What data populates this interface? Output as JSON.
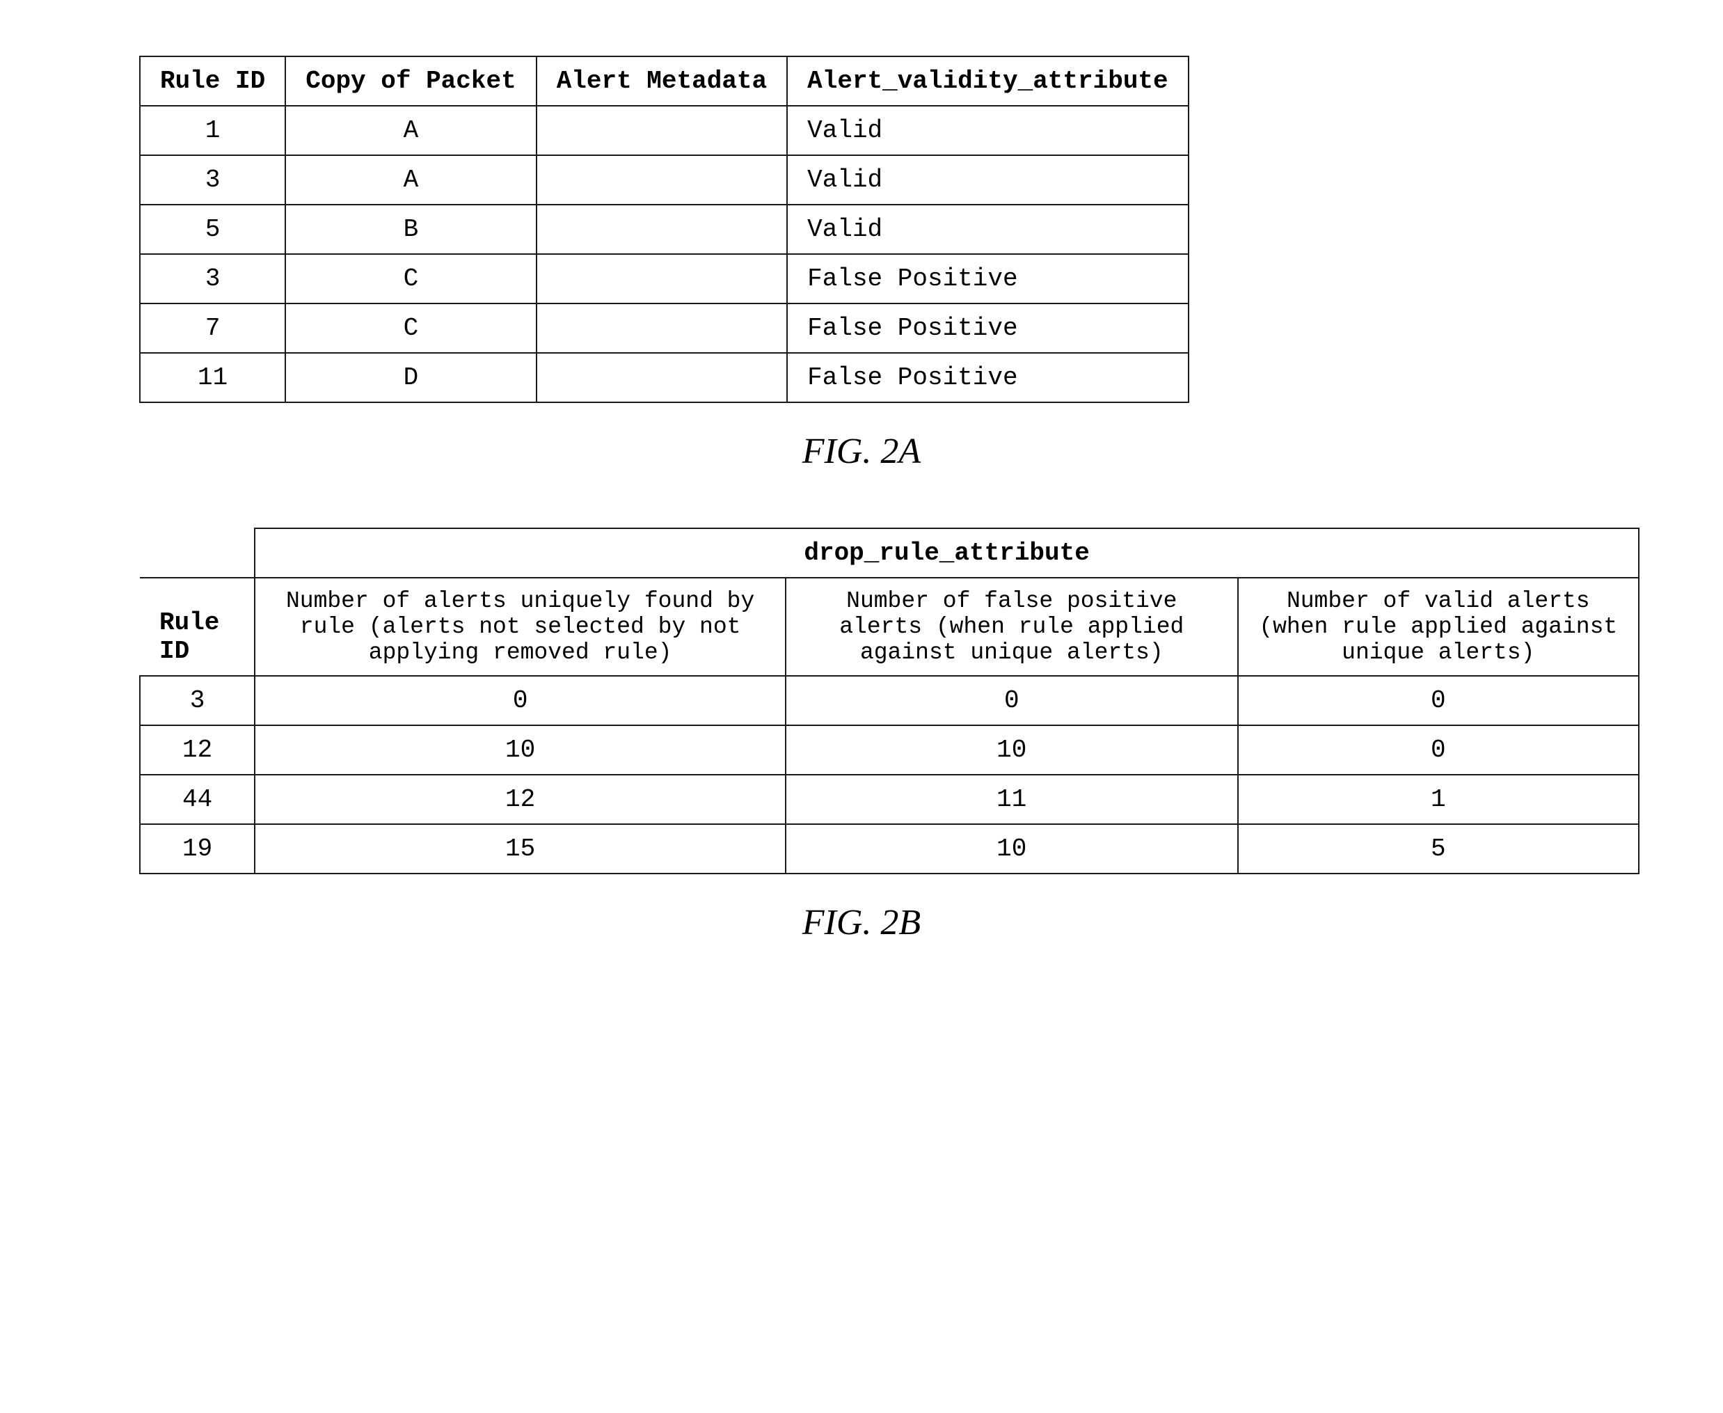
{
  "fig2a": {
    "caption": "FIG. 2A",
    "columns": [
      "Rule ID",
      "Copy of Packet",
      "Alert Metadata",
      "Alert_validity_attribute"
    ],
    "rows": [
      {
        "rule_id": "1",
        "copy_of_packet": "A",
        "alert_metadata": "",
        "alert_validity": "Valid"
      },
      {
        "rule_id": "3",
        "copy_of_packet": "A",
        "alert_metadata": "",
        "alert_validity": "Valid"
      },
      {
        "rule_id": "5",
        "copy_of_packet": "B",
        "alert_metadata": "",
        "alert_validity": "Valid"
      },
      {
        "rule_id": "3",
        "copy_of_packet": "C",
        "alert_metadata": "",
        "alert_validity": "False Positive"
      },
      {
        "rule_id": "7",
        "copy_of_packet": "C",
        "alert_metadata": "",
        "alert_validity": "False Positive"
      },
      {
        "rule_id": "11",
        "copy_of_packet": "D",
        "alert_metadata": "",
        "alert_validity": "False Positive"
      }
    ]
  },
  "fig2b": {
    "caption": "FIG. 2B",
    "drop_rule_attribute_label": "drop_rule_attribute",
    "col_headers": {
      "rule_id": "Rule ID",
      "unique_alerts": "Number of alerts uniquely found by rule (alerts not selected by not applying removed rule)",
      "false_positive": "Number of false positive alerts (when rule applied against unique alerts)",
      "valid_alerts": "Number of valid alerts (when rule applied against unique alerts)"
    },
    "rows": [
      {
        "rule_id": "3",
        "unique_alerts": "0",
        "false_positive": "0",
        "valid_alerts": "0"
      },
      {
        "rule_id": "12",
        "unique_alerts": "10",
        "false_positive": "10",
        "valid_alerts": "0"
      },
      {
        "rule_id": "44",
        "unique_alerts": "12",
        "false_positive": "11",
        "valid_alerts": "1"
      },
      {
        "rule_id": "19",
        "unique_alerts": "15",
        "false_positive": "10",
        "valid_alerts": "5"
      }
    ]
  }
}
